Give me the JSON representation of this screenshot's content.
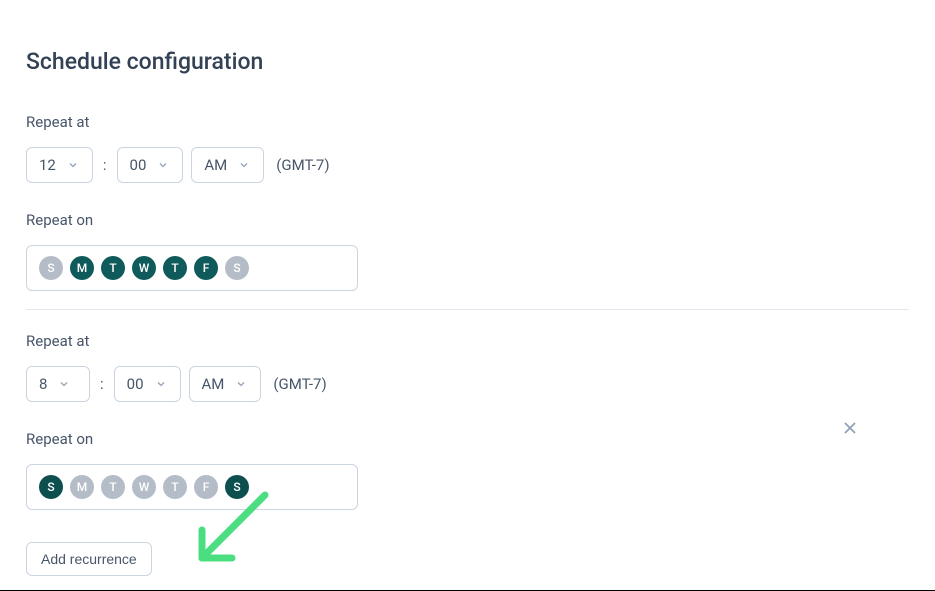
{
  "title": "Schedule configuration",
  "labels": {
    "repeat_at": "Repeat at",
    "repeat_on": "Repeat on",
    "add_recurrence": "Add recurrence"
  },
  "timezone": "(GMT-7)",
  "colon": ":",
  "recurrences": [
    {
      "hour": "12",
      "minute": "00",
      "period": "AM",
      "days": [
        {
          "label": "S",
          "active": false
        },
        {
          "label": "M",
          "active": true
        },
        {
          "label": "T",
          "active": true
        },
        {
          "label": "W",
          "active": true
        },
        {
          "label": "T",
          "active": true
        },
        {
          "label": "F",
          "active": true
        },
        {
          "label": "S",
          "active": false
        }
      ]
    },
    {
      "hour": "8",
      "minute": "00",
      "period": "AM",
      "days": [
        {
          "label": "S",
          "active": true
        },
        {
          "label": "M",
          "active": false
        },
        {
          "label": "T",
          "active": false
        },
        {
          "label": "W",
          "active": false
        },
        {
          "label": "T",
          "active": false
        },
        {
          "label": "F",
          "active": false
        },
        {
          "label": "S",
          "active": true
        }
      ]
    }
  ]
}
